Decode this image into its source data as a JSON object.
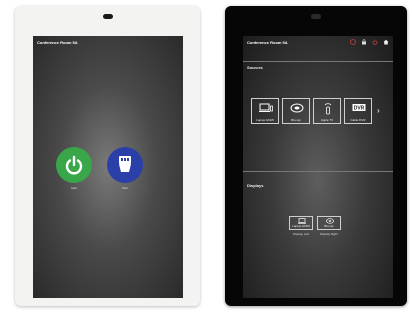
{
  "left_panel": {
    "room_title": "Conference Room 5A",
    "power_label": "Start",
    "hdmi_label": "Start"
  },
  "right_panel": {
    "room_title": "Conference Room 5A",
    "sources_title": "Sources",
    "displays_title": "Displays",
    "sources": [
      {
        "label": "Laptop HDMI",
        "icon": "laptop-icon"
      },
      {
        "label": "Blu-ray",
        "icon": "bluray-disc-icon"
      },
      {
        "label": "Apple TV",
        "icon": "remote-icon"
      },
      {
        "label": "Cable DVR",
        "icon": "dvr-icon"
      }
    ],
    "dvr_text": "DVR",
    "next_arrow": "›",
    "displays": [
      {
        "source": "Laptop HDMI",
        "name": "Display Left"
      },
      {
        "source": "Blu-ray",
        "name": "Display Right"
      }
    ],
    "top_icons": [
      "help-icon",
      "lock-icon",
      "power-icon",
      "home-icon"
    ]
  },
  "colors": {
    "power_green": "#3aa64a",
    "hdmi_blue": "#2b3fa8",
    "alert_red": "#d23b3b"
  }
}
